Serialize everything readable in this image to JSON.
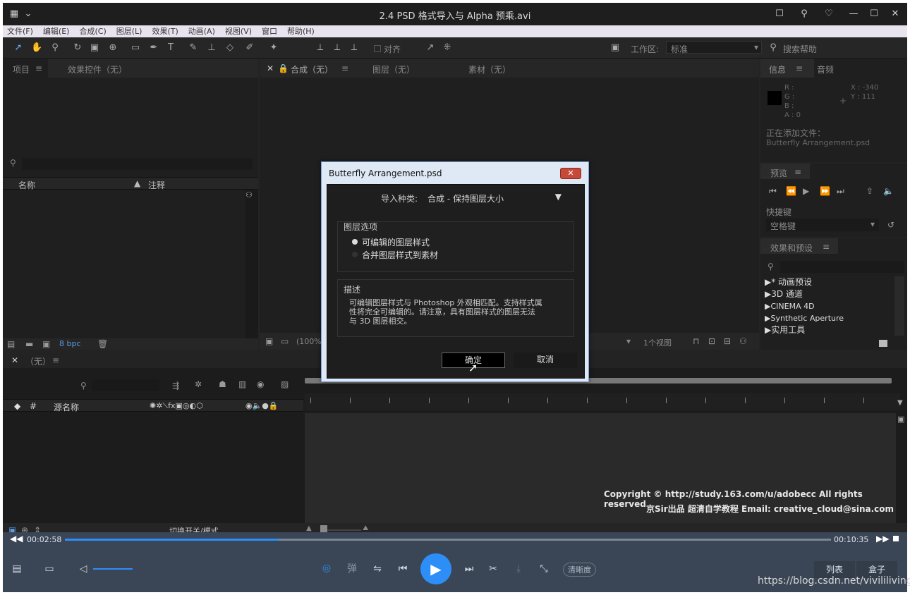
{
  "window": {
    "title": "2.4 PSD 格式导入与 Alpha 预乘.avi"
  },
  "menu": [
    "文件(F)",
    "编辑(E)",
    "合成(C)",
    "图层(L)",
    "效果(T)",
    "动画(A)",
    "视图(V)",
    "窗口",
    "帮助(H)"
  ],
  "toolbar": {
    "align_label": "对齐",
    "workspace_label": "工作区:",
    "workspace_value": "标准",
    "search_help": "搜索帮助"
  },
  "project_panel": {
    "tab_project": "项目",
    "tab_effects": "效果控件（无）",
    "col_name": "名称",
    "col_comment": "注释",
    "bpc": "8 bpc"
  },
  "comp_panel": {
    "tab_comp": "合成（无）",
    "tab_layer": "图层（无）",
    "tab_footage": "素材（无）",
    "zoom": "(100%",
    "views": "1个视图"
  },
  "info_panel": {
    "tab_info": "信息",
    "tab_audio": "音频",
    "r": "R :",
    "g": "G :",
    "b": "B :",
    "a": "A : 0",
    "x": "X : -340",
    "y": "Y : 111",
    "adding_label": "正在添加文件：",
    "adding_file": "Butterfly Arrangement.psd"
  },
  "preview_panel": {
    "tab": "预览",
    "shortcut_label": "快捷键",
    "shortcut_value": "空格键"
  },
  "effects_panel": {
    "tab": "效果和预设",
    "items": [
      "* 动画预设",
      "3D 通道",
      "CINEMA 4D",
      "Synthetic Aperture",
      "实用工具"
    ]
  },
  "timeline": {
    "tab": "（无）",
    "col_hash": "#",
    "col_source": "源名称",
    "toggle_label": "切换开关/模式"
  },
  "dialog": {
    "title": "Butterfly Arrangement.psd",
    "import_kind_label": "导入种类:",
    "import_kind_value": "合成 - 保持图层大小",
    "layer_options_label": "图层选项",
    "option1": "可编辑的图层样式",
    "option2": "合并图层样式到素材",
    "desc_label": "描述",
    "desc_line1": "可编辑图层样式与 Photoshop 外观相匹配。支持样式属",
    "desc_line2": "性将完全可编辑的。请注意，具有图层样式的图层无法",
    "desc_line3": "与 3D 图层相交。",
    "ok": "确定",
    "cancel": "取消"
  },
  "watermark": {
    "line1": "Copyright © http://study.163.com/u/adobecc All rights reserved",
    "line2": "京Sir出品 超清自学教程 Email: creative_cloud@sina.com"
  },
  "player": {
    "current_time": "00:02:58",
    "total_time": "00:10:35",
    "progress": 0.279,
    "danmu": "弹",
    "quality": "清晰度",
    "list": "列表",
    "box": "盒子"
  },
  "csdn": "https://blog.csdn.net/vivililiving"
}
